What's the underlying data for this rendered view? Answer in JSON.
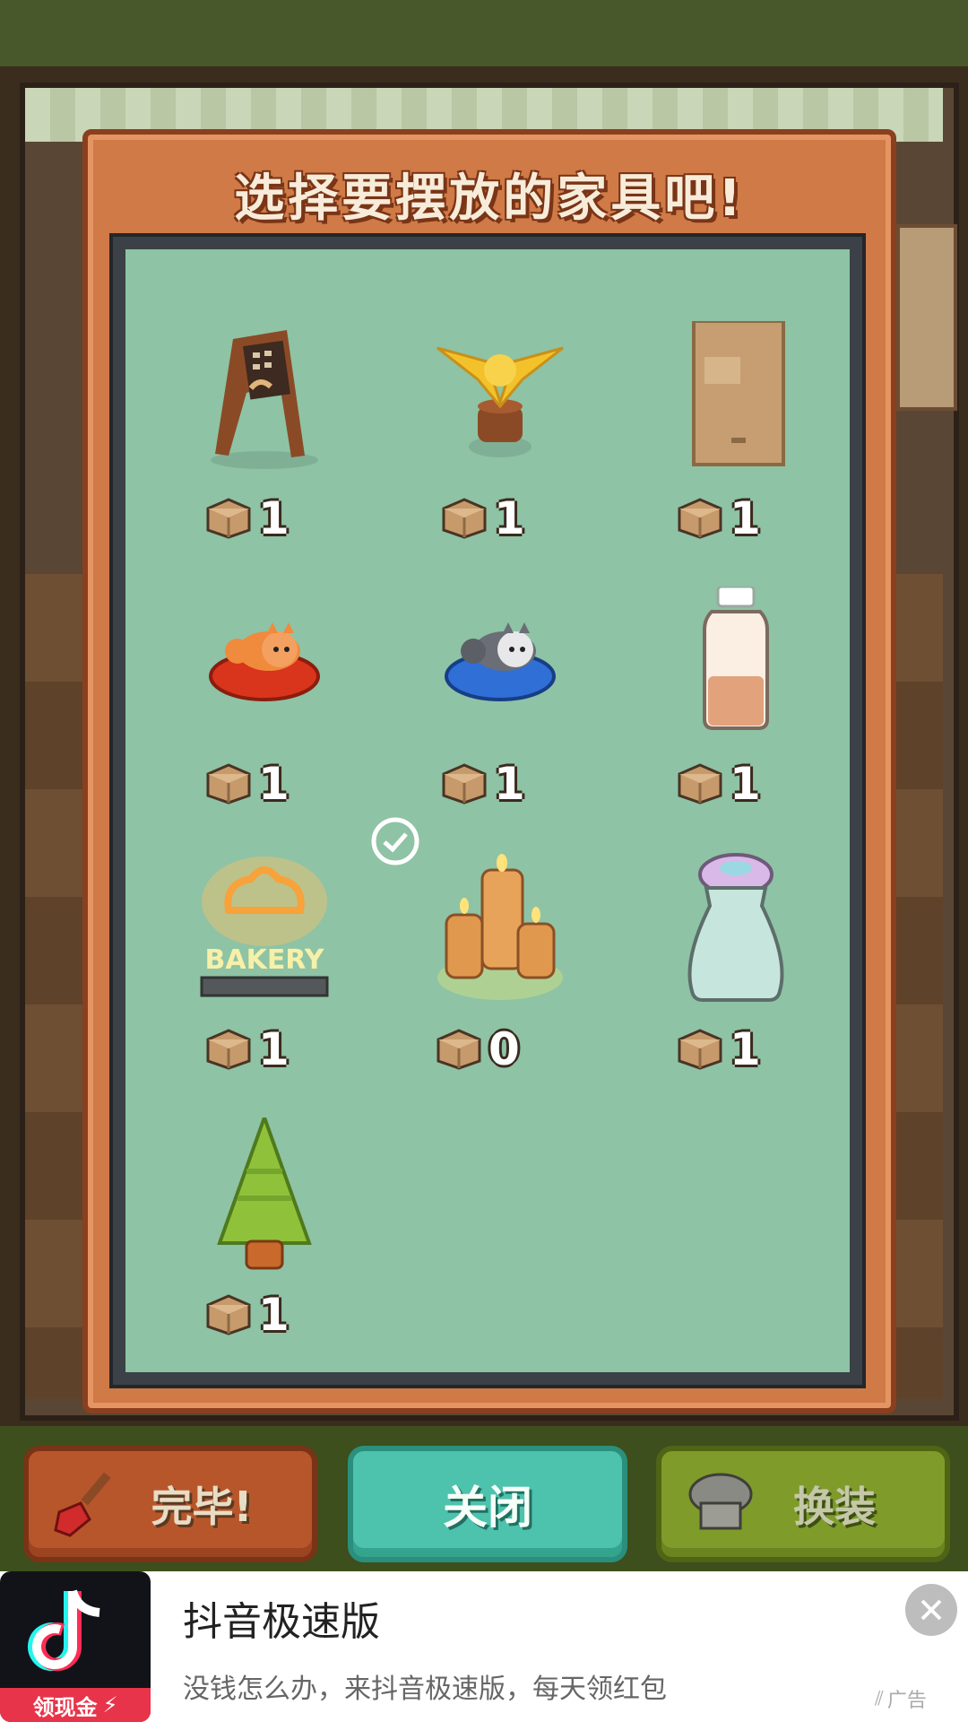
{
  "dialog": {
    "title": "选择要摆放的家具吧!",
    "items": [
      {
        "name": "wooden-sign",
        "count": "1"
      },
      {
        "name": "golden-bird-trophy",
        "count": "1"
      },
      {
        "name": "cardboard-box",
        "count": "1"
      },
      {
        "name": "orange-cat-bed",
        "count": "1"
      },
      {
        "name": "gray-cat-bed",
        "count": "1"
      },
      {
        "name": "milk-bottle",
        "count": "1"
      },
      {
        "name": "bakery-neon-sign",
        "count": "1",
        "sign_text": "BAKERY"
      },
      {
        "name": "candle-cluster",
        "count": "0",
        "selected": true
      },
      {
        "name": "salt-shaker",
        "count": "1"
      },
      {
        "name": "pine-tree",
        "count": "1"
      }
    ]
  },
  "buttons": {
    "done": "完毕!",
    "close": "关闭",
    "dress": "换装"
  },
  "ad": {
    "title": "抖音极速版",
    "subtitle": "没钱怎么办，来抖音极速版，每天领红包",
    "logo_tag": "领现金",
    "tag": "广告"
  },
  "colors": {
    "panel_bg": "#8ec3a5",
    "dialog_frame": "#cf7a47",
    "close_button": "#4dc2ad",
    "done_button": "#b8562b",
    "dress_button": "#7f9b2a"
  }
}
